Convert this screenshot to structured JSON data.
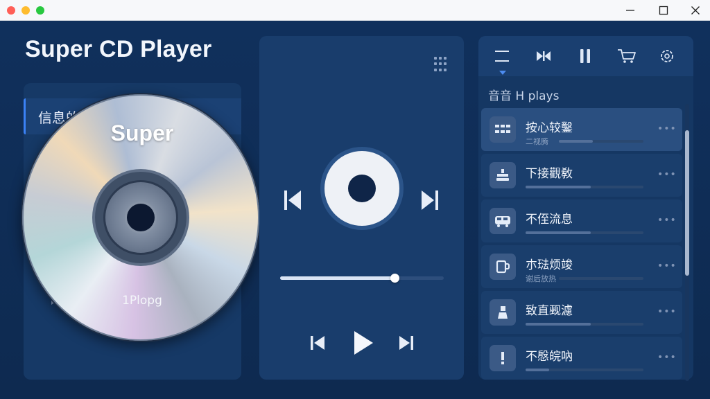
{
  "app": {
    "title": "Super CD Player"
  },
  "window_controls": {
    "minimize": "—",
    "maximize": "☐",
    "close": "✕"
  },
  "left_panel": {
    "info_header": "信息的"
  },
  "cd": {
    "label": "Super",
    "subtitle": "1Plopg"
  },
  "player": {
    "progress": 0.7
  },
  "right_panel": {
    "tabs": [
      "menu-icon",
      "skip-icon",
      "pause-icon",
      "cart-icon",
      "settings-icon"
    ],
    "section_label": "音音 H plays"
  },
  "tracks": [
    {
      "title": "按心较鑿",
      "subtitle": "二视腾",
      "icon": "grid-text-icon",
      "fill": 0.4
    },
    {
      "title": "下接觀敎",
      "subtitle": "",
      "icon": "tray-icon",
      "fill": 0.55
    },
    {
      "title": "不侄流息",
      "subtitle": "",
      "icon": "bus-icon",
      "fill": 0.55
    },
    {
      "title": "朩琺烦竣",
      "subtitle": "谢后放热",
      "icon": "cup-icon",
      "fill": 0.0
    },
    {
      "title": "致直觋濾",
      "subtitle": "",
      "icon": "person-icon",
      "fill": 0.55
    },
    {
      "title": "不慇皖吶",
      "subtitle": "",
      "icon": "exclamation-icon",
      "fill": 0.2
    }
  ],
  "colors": {
    "background": "#0f2a52",
    "panel": "#163966",
    "accent": "#4d8cf0",
    "active_track": "#2a4f80"
  }
}
